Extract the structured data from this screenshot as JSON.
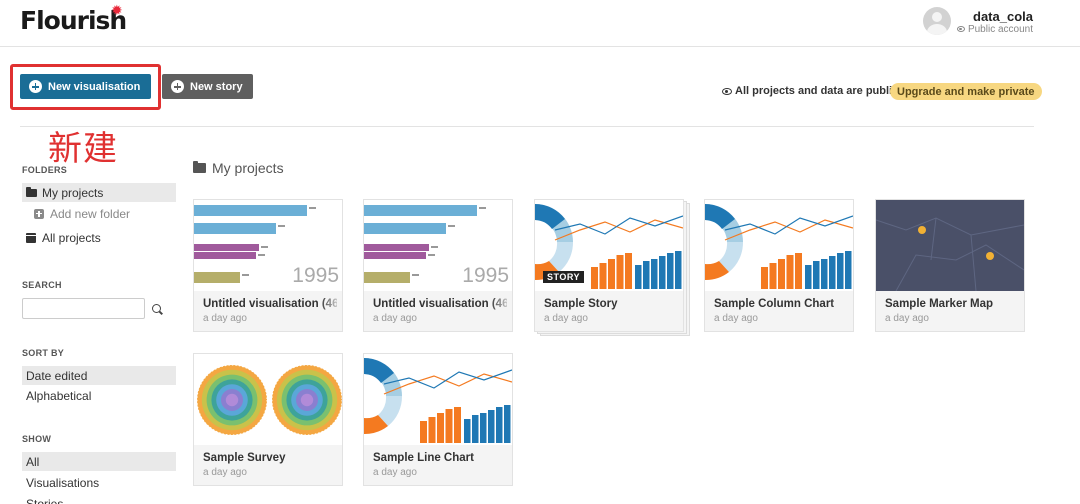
{
  "header": {
    "logo": "Flourish",
    "logo_star": "✹",
    "username": "data_cola",
    "account_type": "Public account"
  },
  "actions": {
    "new_visualisation": "New visualisation",
    "new_story": "New story",
    "annotation": "新建",
    "public_note": "All projects and data are public",
    "upgrade": "Upgrade and make private"
  },
  "sidebar": {
    "folders_label": "FOLDERS",
    "folders": [
      "My projects",
      "Add new folder",
      "All projects"
    ],
    "search_label": "SEARCH",
    "search_value": "",
    "sort_label": "SORT BY",
    "sort_options": [
      "Date edited",
      "Alphabetical"
    ],
    "show_label": "SHOW",
    "show_options": [
      "All",
      "Visualisations",
      "Stories"
    ]
  },
  "main": {
    "title": "My projects",
    "projects": [
      {
        "title": "Untitled visualisation (46",
        "time": "a day ago",
        "year": "1995",
        "thumb": "race"
      },
      {
        "title": "Untitled visualisation (46",
        "time": "a day ago",
        "year": "1995",
        "thumb": "race"
      },
      {
        "title": "Sample Story",
        "time": "a day ago",
        "badge": "STORY",
        "thumb": "combo"
      },
      {
        "title": "Sample Column Chart",
        "time": "a day ago",
        "thumb": "combo"
      },
      {
        "title": "Sample Marker Map",
        "time": "a day ago",
        "thumb": "map"
      },
      {
        "title": "Sample Survey",
        "time": "a day ago",
        "thumb": "survey"
      },
      {
        "title": "Sample Line Chart",
        "time": "a day ago",
        "thumb": "combo"
      }
    ]
  },
  "colors": {
    "primary": "#1a6d96",
    "secondary": "#5f5f5f",
    "highlight": "#e03131",
    "upgrade": "#f7d781",
    "orange": "#f47a20",
    "blue": "#1f78b4",
    "light_blue": "#a6cee3"
  }
}
